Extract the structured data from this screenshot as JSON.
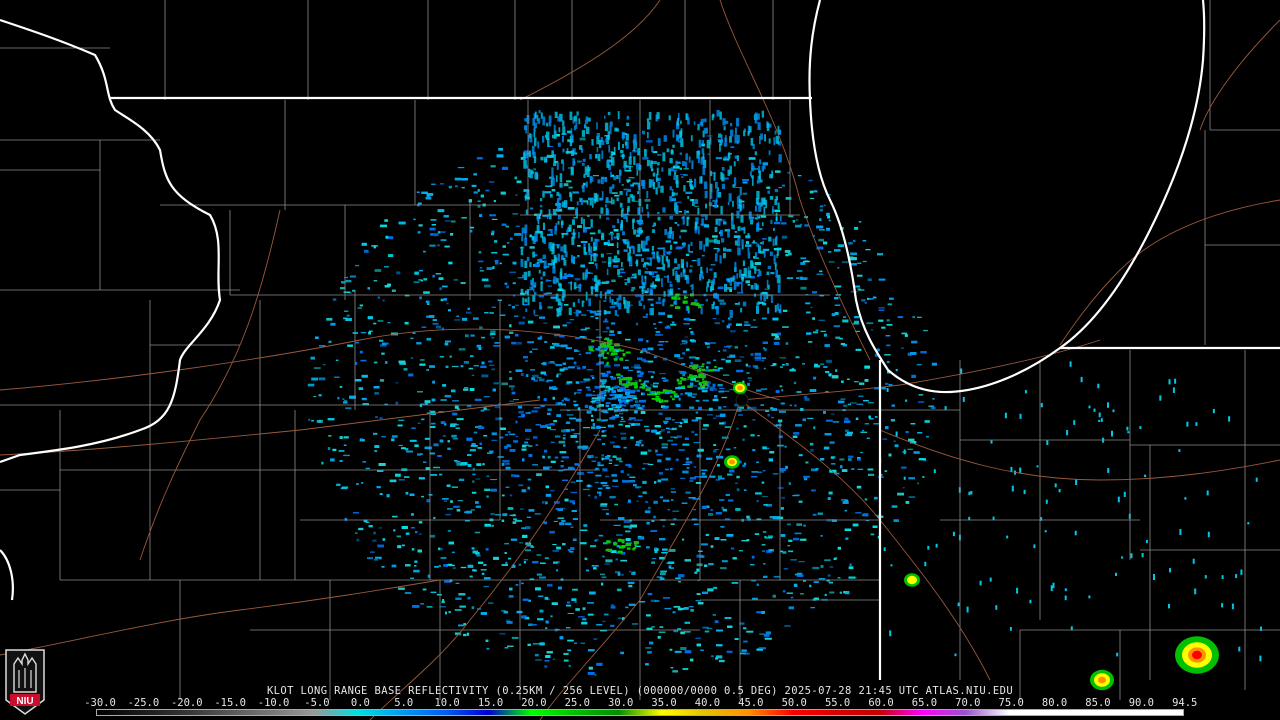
{
  "product": {
    "caption": "KLOT LONG RANGE BASE REFLECTIVITY (0.25KM / 256 LEVEL) (000000/0000 0.5 DEG) 2025-07-28 21:45 UTC  ATLAS.NIU.EDU",
    "station": "KLOT",
    "product_name": "LONG RANGE BASE REFLECTIVITY",
    "resolution": "0.25KM / 256 LEVEL",
    "elevation": "0.5 DEG",
    "date": "2025-07-28",
    "time": "21:45 UTC",
    "site": "ATLAS.NIU.EDU"
  },
  "colorbar": {
    "labels": [
      "-30.0",
      "-25.0",
      "-20.0",
      "-15.0",
      "-10.0",
      "-5.0",
      "0.0",
      "5.0",
      "10.0",
      "15.0",
      "20.0",
      "25.0",
      "30.0",
      "35.0",
      "40.0",
      "45.0",
      "50.0",
      "55.0",
      "60.0",
      "65.0",
      "70.0",
      "75.0",
      "80.0",
      "85.0",
      "90.0",
      "94.5"
    ],
    "colors": [
      "#000000",
      "#1a1a1a",
      "#333333",
      "#555555",
      "#777777",
      "#999999",
      "#00e0e0",
      "#009cf0",
      "#0060f0",
      "#0000d0",
      "#00ff00",
      "#00c000",
      "#009000",
      "#ffff00",
      "#e7c000",
      "#ff9000",
      "#ff0000",
      "#d60000",
      "#c00000",
      "#ff00ff",
      "#9955c9",
      "#ffffff",
      "#ffffff",
      "#ffffff",
      "#ffffff",
      "#ffffff"
    ]
  },
  "logo": {
    "text": "NIU",
    "color": "#c8102e"
  },
  "radar": {
    "site_marker": "radar-site-icon"
  }
}
